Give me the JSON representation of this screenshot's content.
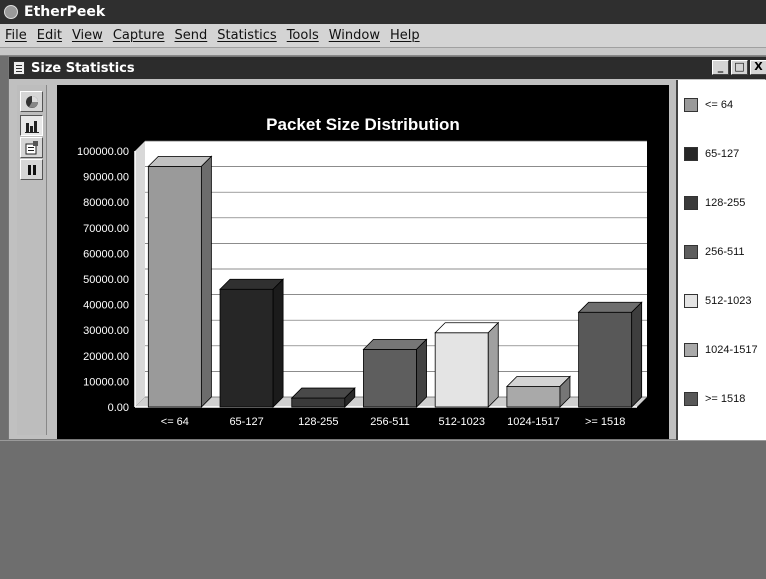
{
  "app": {
    "title": "EtherPeek"
  },
  "menu": [
    "File",
    "Edit",
    "View",
    "Capture",
    "Send",
    "Statistics",
    "Tools",
    "Window",
    "Help"
  ],
  "window": {
    "title": "Size Statistics",
    "controls": [
      "_",
      "□",
      "X"
    ]
  },
  "toolbar": {
    "icons": [
      "pie-chart-icon",
      "bar-chart-icon",
      "properties-icon",
      "pause-icon"
    ],
    "active_index": 1
  },
  "chart_data": {
    "type": "bar",
    "title": "Packet Size Distribution",
    "categories": [
      "<= 64",
      "65-127",
      "128-255",
      "256-511",
      "512-1023",
      "1024-1517",
      ">= 1518"
    ],
    "values": [
      94000,
      46000,
      3500,
      22500,
      29000,
      8000,
      37000
    ],
    "colors": [
      "#9a9a9a",
      "#262626",
      "#3a3a3a",
      "#5e5e5e",
      "#e4e4e4",
      "#a9a9a9",
      "#585858"
    ],
    "yticks": [
      "0.00",
      "10000.00",
      "20000.00",
      "30000.00",
      "40000.00",
      "50000.00",
      "60000.00",
      "70000.00",
      "80000.00",
      "90000.00",
      "100000.00"
    ],
    "ylim": [
      0,
      100000
    ],
    "grid": true,
    "legend_position": "right"
  },
  "legend": {
    "items": [
      {
        "label": "<= 64",
        "color": "#9a9a9a"
      },
      {
        "label": "65-127",
        "color": "#262626"
      },
      {
        "label": "128-255",
        "color": "#3a3a3a"
      },
      {
        "label": "256-511",
        "color": "#5e5e5e"
      },
      {
        "label": "512-1023",
        "color": "#e4e4e4"
      },
      {
        "label": "1024-1517",
        "color": "#a9a9a9"
      },
      {
        "label": ">= 1518",
        "color": "#585858"
      }
    ]
  }
}
